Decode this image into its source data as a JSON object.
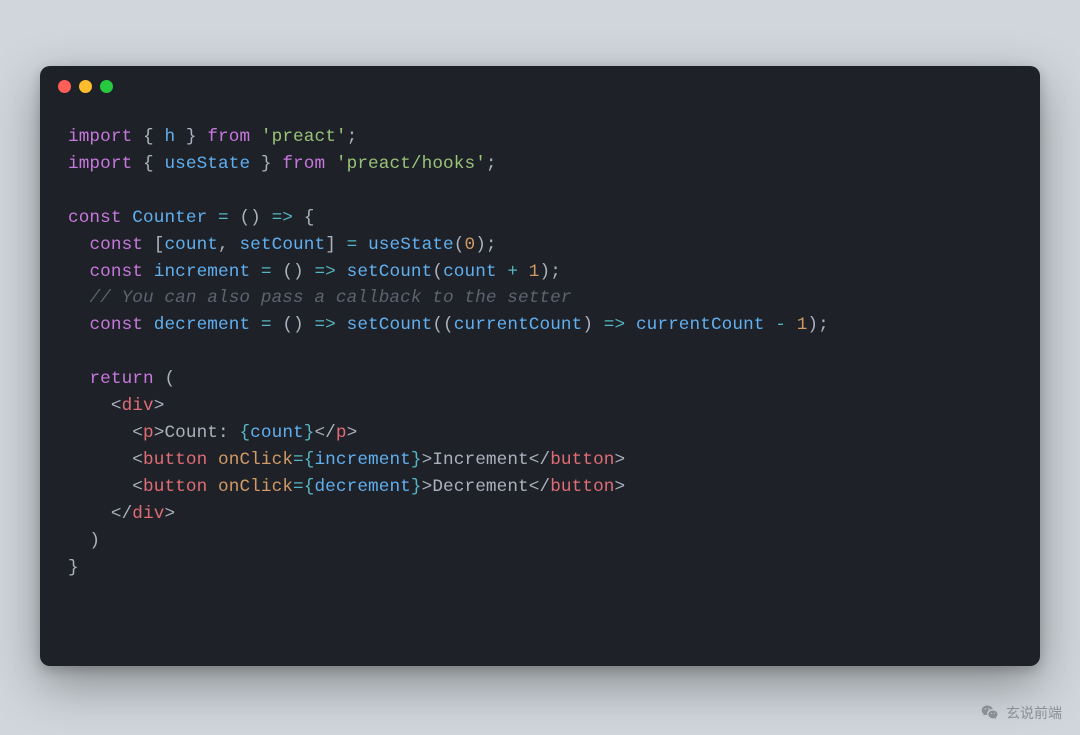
{
  "watermark": {
    "text": "玄说前端"
  },
  "code": {
    "lines": [
      [
        {
          "t": "import",
          "c": "kw"
        },
        {
          "t": " { ",
          "c": "plain"
        },
        {
          "t": "h",
          "c": "fn"
        },
        {
          "t": " } ",
          "c": "plain"
        },
        {
          "t": "from",
          "c": "kw"
        },
        {
          "t": " ",
          "c": "plain"
        },
        {
          "t": "'preact'",
          "c": "str"
        },
        {
          "t": ";",
          "c": "punc"
        }
      ],
      [
        {
          "t": "import",
          "c": "kw"
        },
        {
          "t": " { ",
          "c": "plain"
        },
        {
          "t": "useState",
          "c": "fn"
        },
        {
          "t": " } ",
          "c": "plain"
        },
        {
          "t": "from",
          "c": "kw"
        },
        {
          "t": " ",
          "c": "plain"
        },
        {
          "t": "'preact/hooks'",
          "c": "str"
        },
        {
          "t": ";",
          "c": "punc"
        }
      ],
      [],
      [
        {
          "t": "const",
          "c": "kw"
        },
        {
          "t": " ",
          "c": "plain"
        },
        {
          "t": "Counter",
          "c": "fn"
        },
        {
          "t": " ",
          "c": "plain"
        },
        {
          "t": "=",
          "c": "op"
        },
        {
          "t": " () ",
          "c": "plain"
        },
        {
          "t": "=>",
          "c": "op"
        },
        {
          "t": " {",
          "c": "plain"
        }
      ],
      [
        {
          "t": "  ",
          "c": "plain"
        },
        {
          "t": "const",
          "c": "kw"
        },
        {
          "t": " [",
          "c": "plain"
        },
        {
          "t": "count",
          "c": "fn"
        },
        {
          "t": ", ",
          "c": "plain"
        },
        {
          "t": "setCount",
          "c": "fn"
        },
        {
          "t": "] ",
          "c": "plain"
        },
        {
          "t": "=",
          "c": "op"
        },
        {
          "t": " ",
          "c": "plain"
        },
        {
          "t": "useState",
          "c": "fn"
        },
        {
          "t": "(",
          "c": "plain"
        },
        {
          "t": "0",
          "c": "num"
        },
        {
          "t": ");",
          "c": "plain"
        }
      ],
      [
        {
          "t": "  ",
          "c": "plain"
        },
        {
          "t": "const",
          "c": "kw"
        },
        {
          "t": " ",
          "c": "plain"
        },
        {
          "t": "increment",
          "c": "fn"
        },
        {
          "t": " ",
          "c": "plain"
        },
        {
          "t": "=",
          "c": "op"
        },
        {
          "t": " () ",
          "c": "plain"
        },
        {
          "t": "=>",
          "c": "op"
        },
        {
          "t": " ",
          "c": "plain"
        },
        {
          "t": "setCount",
          "c": "fn"
        },
        {
          "t": "(",
          "c": "plain"
        },
        {
          "t": "count",
          "c": "fn"
        },
        {
          "t": " ",
          "c": "plain"
        },
        {
          "t": "+",
          "c": "op"
        },
        {
          "t": " ",
          "c": "plain"
        },
        {
          "t": "1",
          "c": "num"
        },
        {
          "t": ");",
          "c": "plain"
        }
      ],
      [
        {
          "t": "  ",
          "c": "plain"
        },
        {
          "t": "// You can also pass a callback to the setter",
          "c": "cmt"
        }
      ],
      [
        {
          "t": "  ",
          "c": "plain"
        },
        {
          "t": "const",
          "c": "kw"
        },
        {
          "t": " ",
          "c": "plain"
        },
        {
          "t": "decrement",
          "c": "fn"
        },
        {
          "t": " ",
          "c": "plain"
        },
        {
          "t": "=",
          "c": "op"
        },
        {
          "t": " () ",
          "c": "plain"
        },
        {
          "t": "=>",
          "c": "op"
        },
        {
          "t": " ",
          "c": "plain"
        },
        {
          "t": "setCount",
          "c": "fn"
        },
        {
          "t": "((",
          "c": "plain"
        },
        {
          "t": "currentCount",
          "c": "fn"
        },
        {
          "t": ") ",
          "c": "plain"
        },
        {
          "t": "=>",
          "c": "op"
        },
        {
          "t": " ",
          "c": "plain"
        },
        {
          "t": "currentCount",
          "c": "fn"
        },
        {
          "t": " ",
          "c": "plain"
        },
        {
          "t": "-",
          "c": "op"
        },
        {
          "t": " ",
          "c": "plain"
        },
        {
          "t": "1",
          "c": "num"
        },
        {
          "t": ");",
          "c": "plain"
        }
      ],
      [],
      [
        {
          "t": "  ",
          "c": "plain"
        },
        {
          "t": "return",
          "c": "kw"
        },
        {
          "t": " (",
          "c": "plain"
        }
      ],
      [
        {
          "t": "    ",
          "c": "plain"
        },
        {
          "t": "<",
          "c": "punc"
        },
        {
          "t": "div",
          "c": "tag"
        },
        {
          "t": ">",
          "c": "punc"
        }
      ],
      [
        {
          "t": "      ",
          "c": "plain"
        },
        {
          "t": "<",
          "c": "punc"
        },
        {
          "t": "p",
          "c": "tag"
        },
        {
          "t": ">",
          "c": "punc"
        },
        {
          "t": "Count: ",
          "c": "plain"
        },
        {
          "t": "{",
          "c": "op"
        },
        {
          "t": "count",
          "c": "fn"
        },
        {
          "t": "}",
          "c": "op"
        },
        {
          "t": "</",
          "c": "punc"
        },
        {
          "t": "p",
          "c": "tag"
        },
        {
          "t": ">",
          "c": "punc"
        }
      ],
      [
        {
          "t": "      ",
          "c": "plain"
        },
        {
          "t": "<",
          "c": "punc"
        },
        {
          "t": "button",
          "c": "tag"
        },
        {
          "t": " ",
          "c": "plain"
        },
        {
          "t": "onClick",
          "c": "attr"
        },
        {
          "t": "=",
          "c": "op"
        },
        {
          "t": "{",
          "c": "op"
        },
        {
          "t": "increment",
          "c": "fn"
        },
        {
          "t": "}",
          "c": "op"
        },
        {
          "t": ">",
          "c": "punc"
        },
        {
          "t": "Increment",
          "c": "plain"
        },
        {
          "t": "</",
          "c": "punc"
        },
        {
          "t": "button",
          "c": "tag"
        },
        {
          "t": ">",
          "c": "punc"
        }
      ],
      [
        {
          "t": "      ",
          "c": "plain"
        },
        {
          "t": "<",
          "c": "punc"
        },
        {
          "t": "button",
          "c": "tag"
        },
        {
          "t": " ",
          "c": "plain"
        },
        {
          "t": "onClick",
          "c": "attr"
        },
        {
          "t": "=",
          "c": "op"
        },
        {
          "t": "{",
          "c": "op"
        },
        {
          "t": "decrement",
          "c": "fn"
        },
        {
          "t": "}",
          "c": "op"
        },
        {
          "t": ">",
          "c": "punc"
        },
        {
          "t": "Decrement",
          "c": "plain"
        },
        {
          "t": "</",
          "c": "punc"
        },
        {
          "t": "button",
          "c": "tag"
        },
        {
          "t": ">",
          "c": "punc"
        }
      ],
      [
        {
          "t": "    ",
          "c": "plain"
        },
        {
          "t": "</",
          "c": "punc"
        },
        {
          "t": "div",
          "c": "tag"
        },
        {
          "t": ">",
          "c": "punc"
        }
      ],
      [
        {
          "t": "  )",
          "c": "plain"
        }
      ],
      [
        {
          "t": "}",
          "c": "plain"
        }
      ]
    ]
  }
}
